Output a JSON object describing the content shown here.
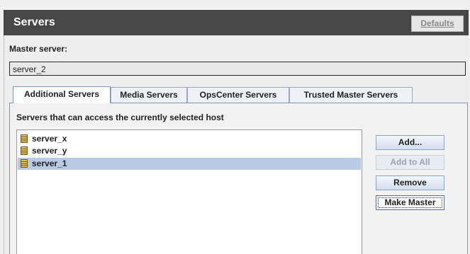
{
  "header": {
    "title": "Servers",
    "defaults_label": "Defaults"
  },
  "master": {
    "label": "Master server:",
    "value": "server_2"
  },
  "tabs": [
    {
      "label": "Additional Servers",
      "active": true
    },
    {
      "label": "Media Servers",
      "active": false
    },
    {
      "label": "OpsCenter Servers",
      "active": false
    },
    {
      "label": "Trusted Master Servers",
      "active": false
    }
  ],
  "panel": {
    "description": "Servers that can access the currently selected host",
    "servers": [
      {
        "name": "server_x",
        "icon": "server-icon",
        "selected": false
      },
      {
        "name": "server_y",
        "icon": "server-icon",
        "selected": false
      },
      {
        "name": "server_1",
        "icon": "server-icon",
        "selected": true
      }
    ]
  },
  "buttons": {
    "add": "Add...",
    "add_to_all": "Add to All",
    "remove": "Remove",
    "make_master": "Make Master"
  },
  "colors": {
    "header_bg": "#474747",
    "selection": "#b9cbe4",
    "tab_border": "#7f96b8"
  }
}
